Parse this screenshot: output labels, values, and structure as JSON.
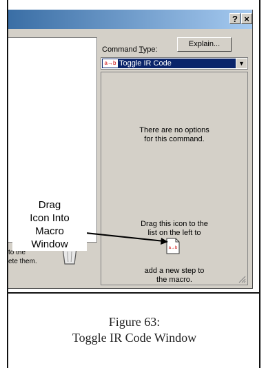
{
  "window": {
    "help_label": "?",
    "close_label": "×",
    "hint_text": "to the\nete them."
  },
  "command": {
    "type_label_pre": "Command ",
    "type_label_key": "T",
    "type_label_post": "ype:",
    "explain_label": "Explain...",
    "selected_icon": "a→b",
    "selected_value": "Toggle IR Code"
  },
  "options_panel": {
    "no_options_text": "There are no options\nfor this command.",
    "drag_text": "Drag this icon to the\nlist on the left to",
    "add_step_text": "add a new step to\nthe macro.",
    "icon_text": "a→b"
  },
  "callout": {
    "text": "Drag\nIcon Into\nMacro\nWindow"
  },
  "caption": {
    "line1": "Figure 63:",
    "line2": "Toggle IR Code Window"
  },
  "icons": [
    "help-icon",
    "close-icon",
    "dropdown-arrow-icon",
    "trash-icon",
    "command-doc-icon",
    "resize-grip-icon"
  ]
}
